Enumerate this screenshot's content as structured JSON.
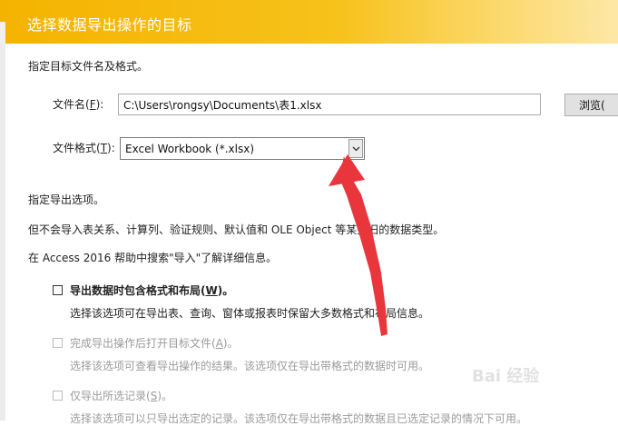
{
  "dialog": {
    "title": "选择数据导出操作的目标",
    "instruction": "指定目标文件名及格式。"
  },
  "file": {
    "name_label_pre": "文件名(",
    "name_label_key": "F",
    "name_label_post": "):",
    "name_value": "C:\\Users\\rongsy\\Documents\\表1.xlsx",
    "browse_label": "浏览(",
    "format_label_pre": "文件格式(",
    "format_label_key": "T",
    "format_label_post": "):",
    "format_value": "Excel Workbook (*.xlsx)"
  },
  "options": {
    "heading": "指定导出选项。",
    "note": "但不会导入表关系、计算列、验证规则、默认值和 OLE Object 等某些旧的数据类型。",
    "help": "在 Access 2016 帮助中搜索\"导入\"了解详细信息。",
    "items": [
      {
        "label_pre": "导出数据时包含格式和布局(",
        "label_key": "W",
        "label_post": ")。",
        "description": "选择该选项可在导出表、查询、窗体或报表时保留大多数格式和布局信息。",
        "checked": false,
        "enabled": true
      },
      {
        "label_pre": "完成导出操作后打开目标文件(",
        "label_key": "A",
        "label_post": ")。",
        "description": "选择该选项可查看导出操作的结果。该选项仅在导出带格式的数据时可用。",
        "checked": false,
        "enabled": false
      },
      {
        "label_pre": "仅导出所选记录(",
        "label_key": "S",
        "label_post": ")。",
        "description": "选择该选项可以只导出选定的记录。该选项仅在导出带格式的数据且已选定记录的情况下可用。",
        "checked": false,
        "enabled": false
      }
    ]
  },
  "watermark": "Bai 经验",
  "colors": {
    "header": "#f5b300",
    "annotation_arrow": "#e8363c"
  }
}
